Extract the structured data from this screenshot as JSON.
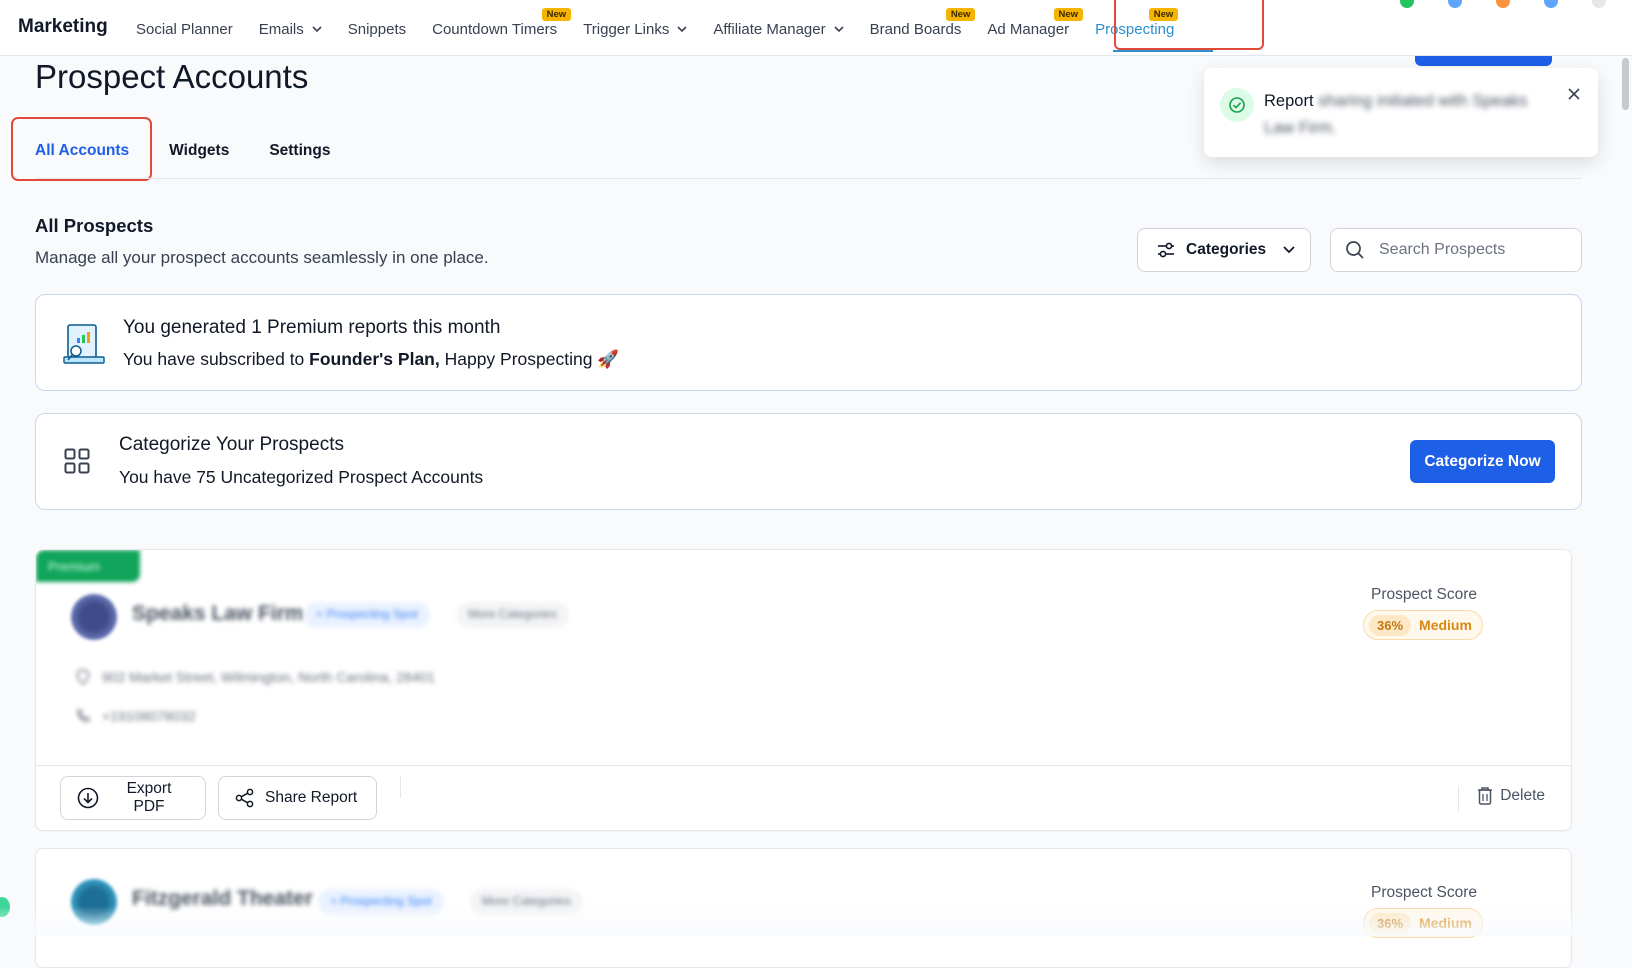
{
  "nav": {
    "brand": "Marketing",
    "items": [
      {
        "label": "Social Planner"
      },
      {
        "label": "Emails"
      },
      {
        "label": "Snippets"
      },
      {
        "label": "Countdown Timers",
        "badge": "New"
      },
      {
        "label": "Trigger Links"
      },
      {
        "label": "Affiliate Manager"
      },
      {
        "label": "Brand Boards",
        "badge": "New"
      },
      {
        "label": "Ad Manager",
        "badge": "New"
      },
      {
        "label": "Prospecting",
        "badge": "New"
      }
    ]
  },
  "page": {
    "title": "Prospect Accounts",
    "tabs": [
      {
        "label": "All Accounts"
      },
      {
        "label": "Widgets"
      },
      {
        "label": "Settings"
      }
    ],
    "section_title": "All Prospects",
    "section_subtitle": "Manage all your prospect accounts seamlessly in one place."
  },
  "filters": {
    "categories_label": "Categories",
    "search_placeholder": "Search Prospects"
  },
  "reports_card": {
    "title": "You generated 1 Premium reports this month",
    "sub_prefix": "You have subscribed to ",
    "plan": "Founder's Plan,",
    "sub_suffix": " Happy Prospecting 🚀"
  },
  "categorize_card": {
    "title": "Categorize Your Prospects",
    "subtitle": "You have 75 Uncategorized Prospect Accounts",
    "button": "Categorize Now"
  },
  "prospects": [
    {
      "ribbon": "Premium",
      "name": "Speaks Law Firm",
      "category": "+ Prospecting Spot",
      "more": "More Categories",
      "address": "902 Market Street, Wilmington, North Carolina, 28401",
      "phone": "+19108078032",
      "score_label": "Prospect Score",
      "score_pct": "36%",
      "score_level": "Medium",
      "export_label": "Export PDF",
      "share_label": "Share Report",
      "delete_label": "Delete"
    },
    {
      "name": "Fitzgerald Theater",
      "category": "+ Prospecting Spot",
      "more": "More Categories",
      "score_label": "Prospect Score",
      "score_pct": "36%",
      "score_level": "Medium"
    }
  ],
  "toast": {
    "lead": "Report",
    "rest": " sharing initiated with Speaks Law Firm."
  },
  "colors": {
    "accent": "#1d5fe6",
    "active_nav": "#2b8fcf",
    "highlight": "#e04a3a",
    "premium": "#10a55a",
    "score_medium": "#d9870f"
  }
}
